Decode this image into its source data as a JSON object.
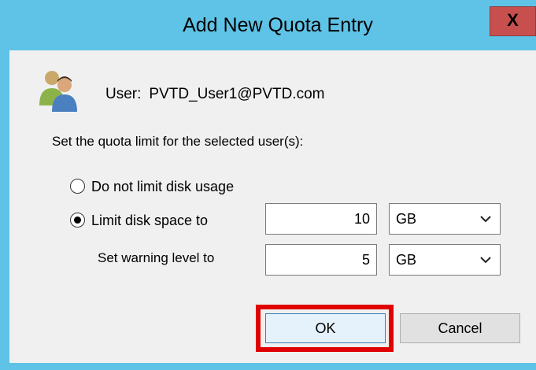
{
  "window": {
    "title": "Add New Quota Entry",
    "close_label": "X"
  },
  "user": {
    "label": "User:",
    "value": "PVTD_User1@PVTD.com",
    "icon": "users-icon"
  },
  "instruction": "Set the quota limit for the selected user(s):",
  "options": {
    "no_limit_label": "Do not limit disk usage",
    "no_limit_selected": false,
    "limit_label": "Limit disk space to",
    "limit_selected": true
  },
  "limit": {
    "value": "10",
    "unit": "GB"
  },
  "warning": {
    "label": "Set warning level to",
    "value": "5",
    "unit": "GB"
  },
  "buttons": {
    "ok": "OK",
    "cancel": "Cancel"
  },
  "colors": {
    "titlebar": "#5ec3e6",
    "close_button": "#c7504f",
    "highlight": "#e00000",
    "client_bg": "#f0f0f0"
  }
}
